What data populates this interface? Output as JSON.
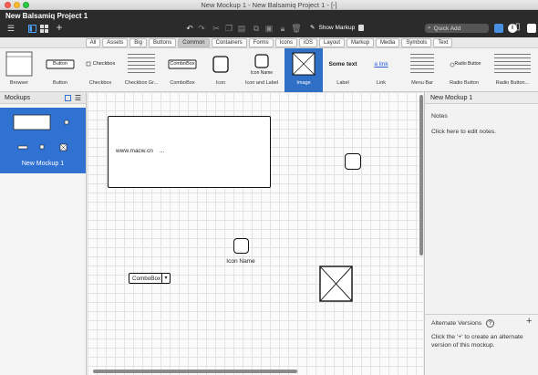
{
  "window": {
    "title": "New Mockup 1 - New Balsamiq Project 1 - [-]"
  },
  "app": {
    "project_name": "New Balsamiq Project 1",
    "show_markup_label": "Show Markup",
    "quick_add_placeholder": "Quick Add"
  },
  "categories": [
    "All",
    "Assets",
    "Big",
    "Buttons",
    "Common",
    "Containers",
    "Forms",
    "Icons",
    "iOS",
    "Layout",
    "Markup",
    "Media",
    "Symbols",
    "Text"
  ],
  "selected_category": "Common",
  "library": [
    {
      "label": "Browser",
      "preview": ""
    },
    {
      "label": "Button",
      "preview": "Button"
    },
    {
      "label": "Checkbox",
      "preview": "Checkbox"
    },
    {
      "label": "Checkbox Gr...",
      "preview": ""
    },
    {
      "label": "ComboBox",
      "preview": "ComboBox"
    },
    {
      "label": "Icon",
      "preview": ""
    },
    {
      "label": "Icon and Label",
      "preview": "Icon Name"
    },
    {
      "label": "Image",
      "preview": ""
    },
    {
      "label": "Label",
      "preview": "Some text"
    },
    {
      "label": "Link",
      "preview": "a link"
    },
    {
      "label": "Menu Bar",
      "preview": ""
    },
    {
      "label": "Radio Button",
      "preview": "Radio Button"
    },
    {
      "label": "Radio Button...",
      "preview": ""
    }
  ],
  "selected_library_item": "Image",
  "sidebar": {
    "title": "Mockups",
    "mockup_name": "New Mockup 1"
  },
  "canvas": {
    "browser_text": "www.macw.cn",
    "browser_dots": "...",
    "icon_label": "Icon Name",
    "combobox_text": "ComboBox"
  },
  "right_panel": {
    "title": "New Mockup 1",
    "notes_label": "Notes",
    "notes_hint": "Click here to edit notes.",
    "alt_versions_label": "Alternate Versions",
    "alt_hint_line1": "Click the '+' to create an alternate",
    "alt_hint_line2": "version of this mockup."
  },
  "colors": {
    "selection": "#2f6fc5",
    "app_bar": "#2b2b2b"
  }
}
